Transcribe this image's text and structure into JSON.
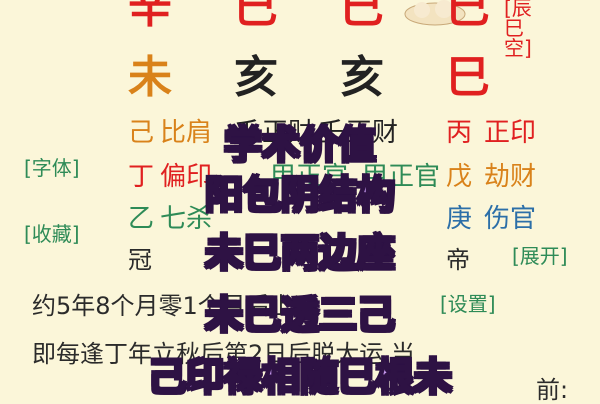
{
  "stems": [
    "辛",
    "巳",
    "巳",
    "巳"
  ],
  "branches": [
    "未",
    "亥",
    "亥",
    "巳"
  ],
  "void_label": "[辰巳空]",
  "hidden": {
    "row1": [
      "己",
      "比肩",
      "壬",
      "正财",
      "壬",
      "正财",
      "丙",
      "正印"
    ],
    "row2": [
      "丁",
      "偏印",
      "甲",
      "正官",
      "甲",
      "正官",
      "戊",
      "劫财"
    ],
    "row3": [
      "乙",
      "七杀",
      "庚",
      "伤官"
    ]
  },
  "phases": [
    "冠",
    "帝"
  ],
  "links": {
    "font": "[字体]",
    "collect": "[收藏]",
    "expand": "[展开]",
    "settings": "[设置]"
  },
  "text_lines": {
    "line1": "约5年8个月零1个月后上运",
    "line2": "即每逢丁年立秋后第2日后脱大运,当",
    "line3": "前:"
  },
  "overlay": [
    "学术价值",
    "阳包阴结构",
    "未巳两边座",
    "未巳透三己",
    "己印禄相随巳根未"
  ],
  "colors": {
    "background": "#fbf6d9",
    "red": "#e02020",
    "orange": "#d9821a",
    "green": "#2e8b57",
    "blue": "#2c6fa8",
    "dark": "#222222",
    "overlay_fill": "#c79af0",
    "overlay_stroke": "#2e1244"
  }
}
